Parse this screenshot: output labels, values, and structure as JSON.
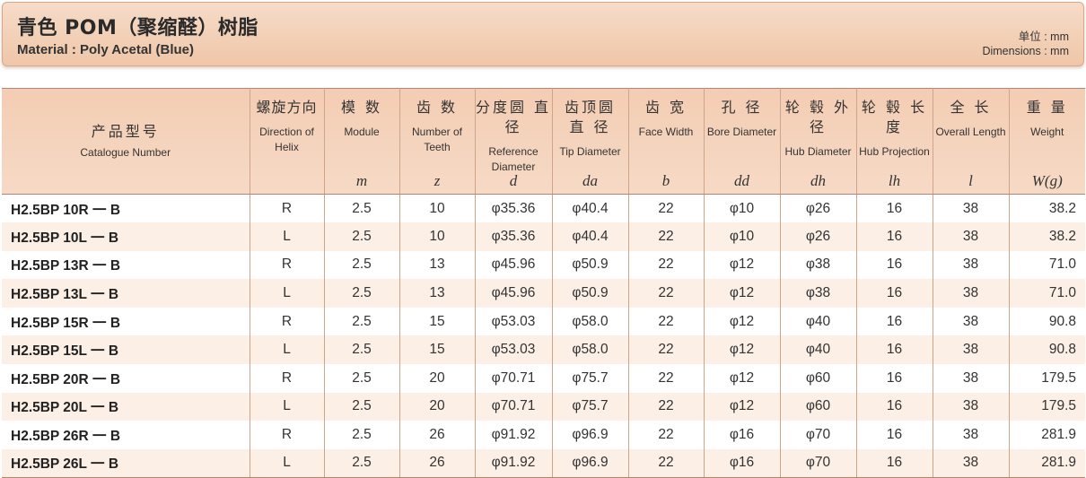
{
  "header": {
    "title_cn": "青色 POM（聚缩醛）树脂",
    "title_en": "Material : Poly Acetal (Blue)",
    "unit_cn": "单位 : mm",
    "unit_en": "Dimensions : mm"
  },
  "columns": [
    {
      "cn": "产品型号",
      "en": "Catalogue Number",
      "sym": ""
    },
    {
      "cn": "螺旋方向",
      "en": "Direction of Helix",
      "sym": ""
    },
    {
      "cn": "模 数",
      "en": "Module",
      "sym": "m"
    },
    {
      "cn": "齿 数",
      "en": "Number of Teeth",
      "sym": "z"
    },
    {
      "cn": "分度圆 直 径",
      "en": "Reference Diameter",
      "sym": "d"
    },
    {
      "cn": "齿顶圆 直 径",
      "en": "Tip Diameter",
      "sym": "da"
    },
    {
      "cn": "齿 宽",
      "en": "Face Width",
      "sym": "b"
    },
    {
      "cn": "孔 径",
      "en": "Bore Diameter",
      "sym": "dd"
    },
    {
      "cn": "轮 毂 外 径",
      "en": "Hub Diameter",
      "sym": "dh"
    },
    {
      "cn": "轮 毂 长 度",
      "en": "Hub Projection",
      "sym": "lh"
    },
    {
      "cn": "全 长",
      "en": "Overall Length",
      "sym": "l"
    },
    {
      "cn": "重 量",
      "en": "Weight",
      "sym": "W(g)"
    }
  ],
  "rows": [
    [
      "H2.5BP 10R 一 B",
      "R",
      "2.5",
      "10",
      "φ35.36",
      "φ40.4",
      "22",
      "φ10",
      "φ26",
      "16",
      "38",
      "38.2"
    ],
    [
      "H2.5BP 10L 一 B",
      "L",
      "2.5",
      "10",
      "φ35.36",
      "φ40.4",
      "22",
      "φ10",
      "φ26",
      "16",
      "38",
      "38.2"
    ],
    [
      "H2.5BP 13R 一 B",
      "R",
      "2.5",
      "13",
      "φ45.96",
      "φ50.9",
      "22",
      "φ12",
      "φ38",
      "16",
      "38",
      "71.0"
    ],
    [
      "H2.5BP 13L 一 B",
      "L",
      "2.5",
      "13",
      "φ45.96",
      "φ50.9",
      "22",
      "φ12",
      "φ38",
      "16",
      "38",
      "71.0"
    ],
    [
      "H2.5BP 15R 一 B",
      "R",
      "2.5",
      "15",
      "φ53.03",
      "φ58.0",
      "22",
      "φ12",
      "φ40",
      "16",
      "38",
      "90.8"
    ],
    [
      "H2.5BP 15L 一 B",
      "L",
      "2.5",
      "15",
      "φ53.03",
      "φ58.0",
      "22",
      "φ12",
      "φ40",
      "16",
      "38",
      "90.8"
    ],
    [
      "H2.5BP 20R 一 B",
      "R",
      "2.5",
      "20",
      "φ70.71",
      "φ75.7",
      "22",
      "φ12",
      "φ60",
      "16",
      "38",
      "179.5"
    ],
    [
      "H2.5BP 20L 一 B",
      "L",
      "2.5",
      "20",
      "φ70.71",
      "φ75.7",
      "22",
      "φ12",
      "φ60",
      "16",
      "38",
      "179.5"
    ],
    [
      "H2.5BP 26R 一 B",
      "R",
      "2.5",
      "26",
      "φ91.92",
      "φ96.9",
      "22",
      "φ16",
      "φ70",
      "16",
      "38",
      "281.9"
    ],
    [
      "H2.5BP 26L 一 B",
      "L",
      "2.5",
      "26",
      "φ91.92",
      "φ96.9",
      "22",
      "φ16",
      "φ70",
      "16",
      "38",
      "281.9"
    ]
  ]
}
